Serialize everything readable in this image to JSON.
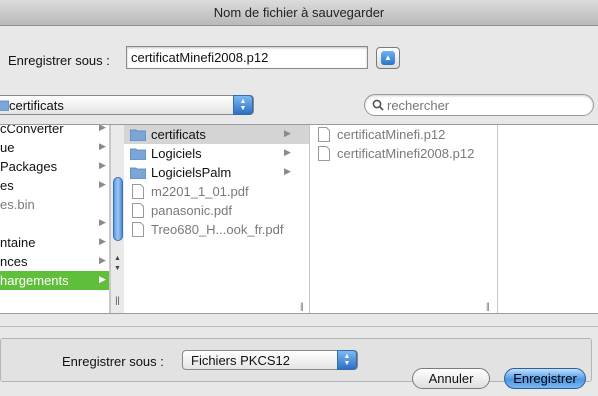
{
  "window": {
    "title": "Nom de fichier à sauvegarder"
  },
  "save_as": {
    "label": "Enregistrer sous :",
    "value": "certificatMinefi2008.p12"
  },
  "location": {
    "selected": "certificats"
  },
  "search": {
    "placeholder": "rechercher"
  },
  "browser": {
    "column1": [
      {
        "label": "cConverter",
        "chevron": true
      },
      {
        "label": "ue",
        "chevron": true
      },
      {
        "label": " Packages",
        "chevron": true
      },
      {
        "label": "es",
        "chevron": true
      },
      {
        "label": "es.bin",
        "chevron": false,
        "dim": true
      },
      {
        "label": "",
        "chevron": true
      },
      {
        "label": "ntaine",
        "chevron": true
      },
      {
        "label": "nces",
        "chevron": true
      },
      {
        "label": "hargements",
        "chevron": true,
        "selected": true
      }
    ],
    "column2": [
      {
        "label": "certificats",
        "kind": "folder",
        "chevron": true,
        "selected": true
      },
      {
        "label": "Logiciels",
        "kind": "folder",
        "chevron": true
      },
      {
        "label": "LogicielsPalm",
        "kind": "folder",
        "chevron": true
      },
      {
        "label": "m2201_1_01.pdf",
        "kind": "document",
        "dim": true
      },
      {
        "label": "panasonic.pdf",
        "kind": "document",
        "dim": true
      },
      {
        "label": "Treo680_H...ook_fr.pdf",
        "kind": "document",
        "dim": true
      }
    ],
    "column3": [
      {
        "label": "certificatMinefi.p12",
        "kind": "document",
        "dim": true
      },
      {
        "label": "certificatMinefi2008.p12",
        "kind": "document",
        "dim": true
      }
    ]
  },
  "format": {
    "label": "Enregistrer sous :",
    "selected": "Fichiers PKCS12"
  },
  "buttons": {
    "cancel": "Annuler",
    "save": "Enregistrer"
  },
  "colors": {
    "accent": "#3b82d8",
    "selection_green": "#5fbf3a",
    "selection_gray": "#d4d4d4"
  }
}
